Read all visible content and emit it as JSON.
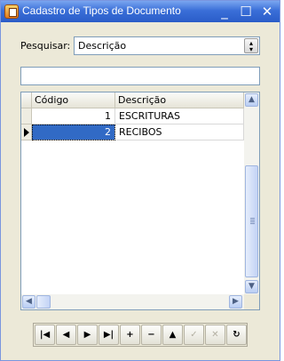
{
  "window": {
    "title": "Cadastro de Tipos de Documento"
  },
  "titlebar_buttons": {
    "minimize": "_",
    "maximize": "☐",
    "close": "✕"
  },
  "filter": {
    "label": "Pesquisar:",
    "selected": "Descrição",
    "search_value": ""
  },
  "table": {
    "columns": [
      "Código",
      "Descrição"
    ],
    "rows": [
      {
        "codigo": "1",
        "descricao": "ESCRITURAS"
      },
      {
        "codigo": "2",
        "descricao": "RECIBOS"
      }
    ],
    "selected_row_index": 1
  },
  "navigator": {
    "buttons": [
      {
        "name": "first",
        "glyph": "|◀",
        "enabled": true
      },
      {
        "name": "prior",
        "glyph": "◀",
        "enabled": true
      },
      {
        "name": "next",
        "glyph": "▶",
        "enabled": true
      },
      {
        "name": "last",
        "glyph": "▶|",
        "enabled": true
      },
      {
        "name": "insert",
        "glyph": "+",
        "enabled": true
      },
      {
        "name": "delete",
        "glyph": "−",
        "enabled": true
      },
      {
        "name": "edit",
        "glyph": "▲",
        "enabled": true
      },
      {
        "name": "post",
        "glyph": "✓",
        "enabled": false
      },
      {
        "name": "cancel",
        "glyph": "✕",
        "enabled": false
      },
      {
        "name": "refresh",
        "glyph": "↻",
        "enabled": true
      }
    ]
  },
  "colors": {
    "title_bar": "#2a5cc8",
    "selection": "#316ac5",
    "window_bg": "#ece9d8"
  }
}
